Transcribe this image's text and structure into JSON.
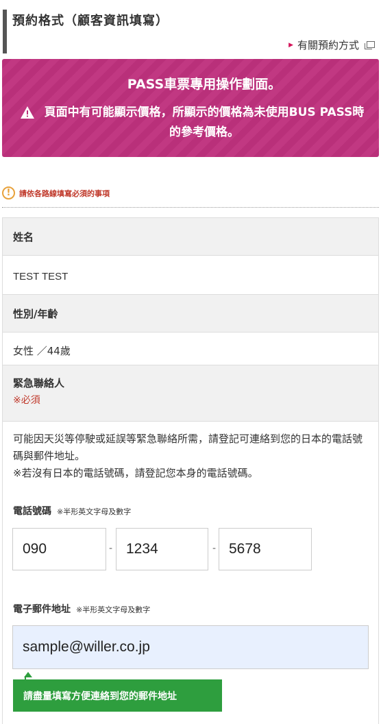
{
  "header": {
    "title": "預約格式（顧客資訊填寫）",
    "help_link": "有關預約方式"
  },
  "banner": {
    "title": "PASS車票專用操作劃面。",
    "body": "頁面中有可能顯示價格，所顯示的價格為未使用BUS PASS時的參考價格。"
  },
  "notice": {
    "icon": "!",
    "text": "請依各路線填寫必須的事項"
  },
  "form": {
    "name_label": "姓名",
    "name_value": "TEST TEST",
    "gender_age_label": "性別/年齡",
    "gender_age_value": "女性 ／44歲",
    "emergency_label": "緊急聯絡人",
    "required_mark": "※必須",
    "description_line1": "可能因天災等停駛或延誤等緊急聯絡所需，請登記可連絡到您的日本的電話號碼與郵件地址。",
    "description_line2": "※若沒有日本的電話號碼，請登記您本身的電話號碼。",
    "phone_label": "電話號碼",
    "phone_note": "※半形英文字母及數字",
    "phone": [
      "090",
      "1234",
      "5678"
    ],
    "dash": "-",
    "email_label": "電子郵件地址",
    "email_note": "※半形英文字母及數字",
    "email_value": "sample@willer.co.jp",
    "email_tip": "請盡量填寫方便連絡到您的郵件地址"
  },
  "colors": {
    "banner_magenta": "#b9307a",
    "required_red": "#c0392b",
    "tip_green": "#2e9e3e",
    "email_autofill_bg": "#e8f0fe"
  }
}
